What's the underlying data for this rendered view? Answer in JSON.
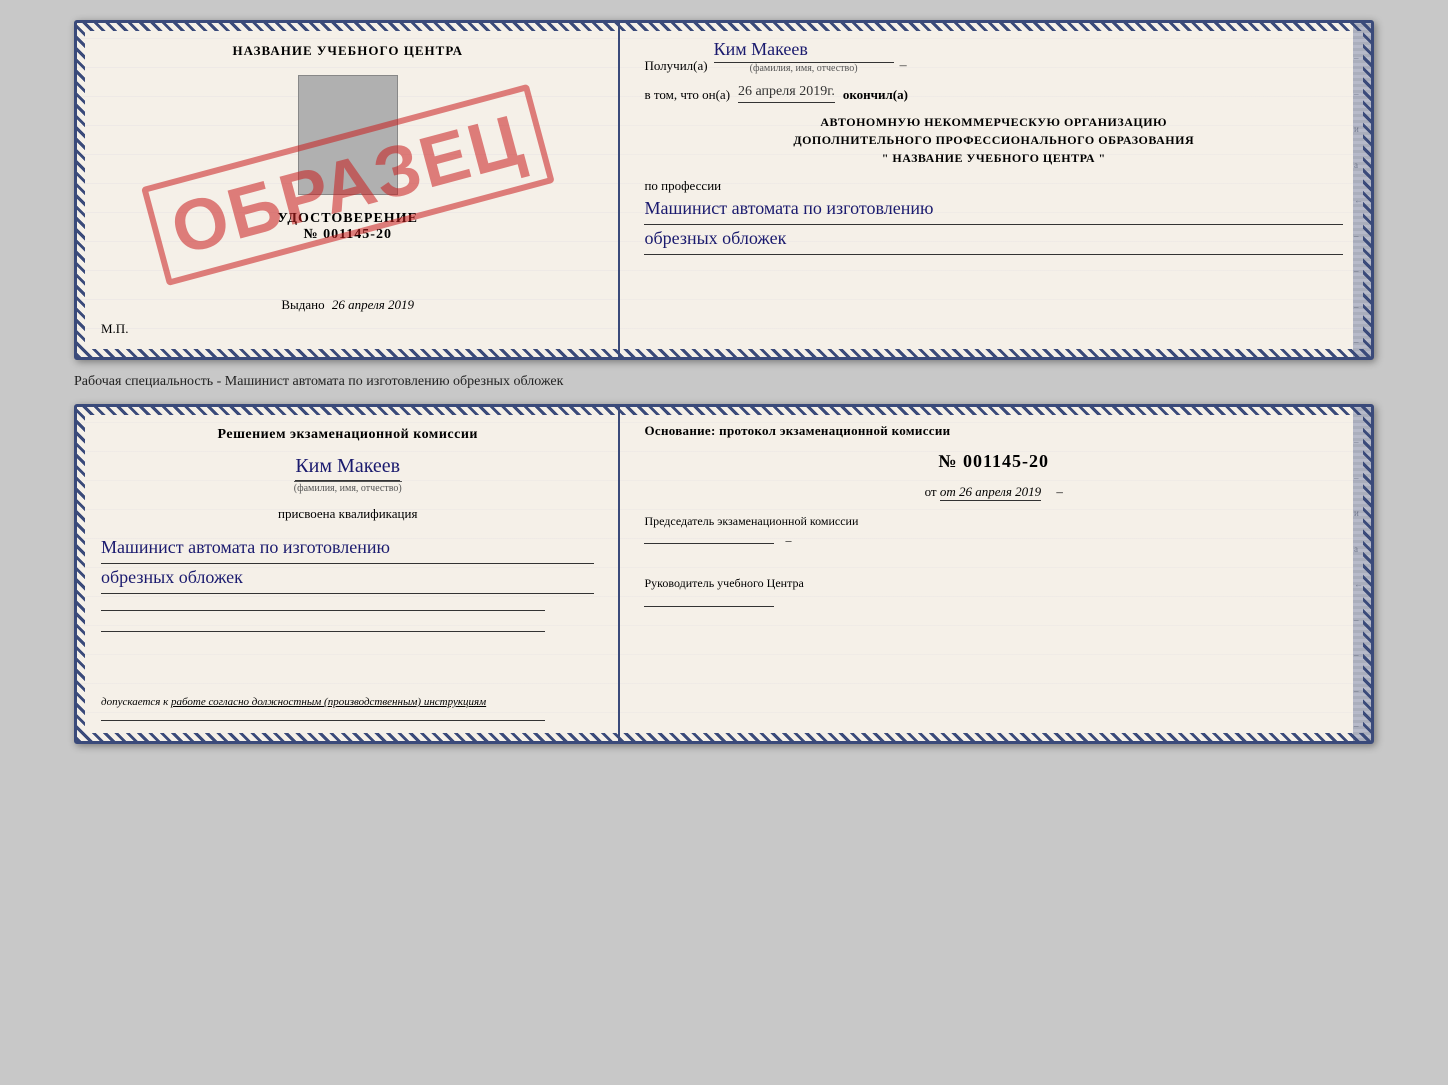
{
  "top_cert": {
    "left": {
      "school_name": "НАЗВАНИЕ УЧЕБНОГО ЦЕНТРА",
      "udost_label": "УДОСТОВЕРЕНИЕ",
      "udost_number": "№ 001145-20",
      "issued_prefix": "Выдано",
      "issued_date": "26 апреля 2019",
      "mp_label": "М.П.",
      "stamp_text": "ОБРАЗЕЦ"
    },
    "right": {
      "recipient_prefix": "Получил(а)",
      "recipient_name": "Ким Макеев",
      "recipient_sublabel": "(фамилия, имя, отчество)",
      "dash1": "–",
      "date_prefix": "в том, что он(а)",
      "date_value": "26 апреля 2019г.",
      "finished_suffix": "окончил(а)",
      "org_line1": "АВТОНОМНУЮ НЕКОММЕРЧЕСКУЮ ОРГАНИЗАЦИЮ",
      "org_line2": "ДОПОЛНИТЕЛЬНОГО ПРОФЕССИОНАЛЬНОГО ОБРАЗОВАНИЯ",
      "org_name": "\" НАЗВАНИЕ УЧЕБНОГО ЦЕНТРА \"",
      "dash_i": "и",
      "dash_a": "а",
      "dash_arrow": "←",
      "profession_prefix": "по профессии",
      "profession_handwritten": "Машинист автомата по изготовлению",
      "profession_handwritten2": "обрезных обложек"
    }
  },
  "subtitle": "Рабочая специальность - Машинист автомата по изготовлению обрезных обложек",
  "bottom_cert": {
    "left": {
      "decision_header": "Решением экзаменационной комиссии",
      "person_name": "Ким Макеев",
      "fio_sublabel": "(фамилия, имя, отчество)",
      "assigned_text": "присвоена квалификация",
      "qualification_line1": "Машинист автомата по изготовлению",
      "qualification_line2": "обрезных обложек",
      "work_text": "допускается к работе согласно должностным (производственным) инструкциям"
    },
    "right": {
      "osnov_label": "Основание: протокол экзаменационной комиссии",
      "protokol_number": "№ 001145-20",
      "ot_text": "от 26 апреля 2019",
      "chairman_label": "Председатель экзаменационной комиссии",
      "director_label": "Руководитель учебного Центра",
      "dash_i": "и",
      "dash_a": "а",
      "dash_arrow": "←"
    }
  }
}
